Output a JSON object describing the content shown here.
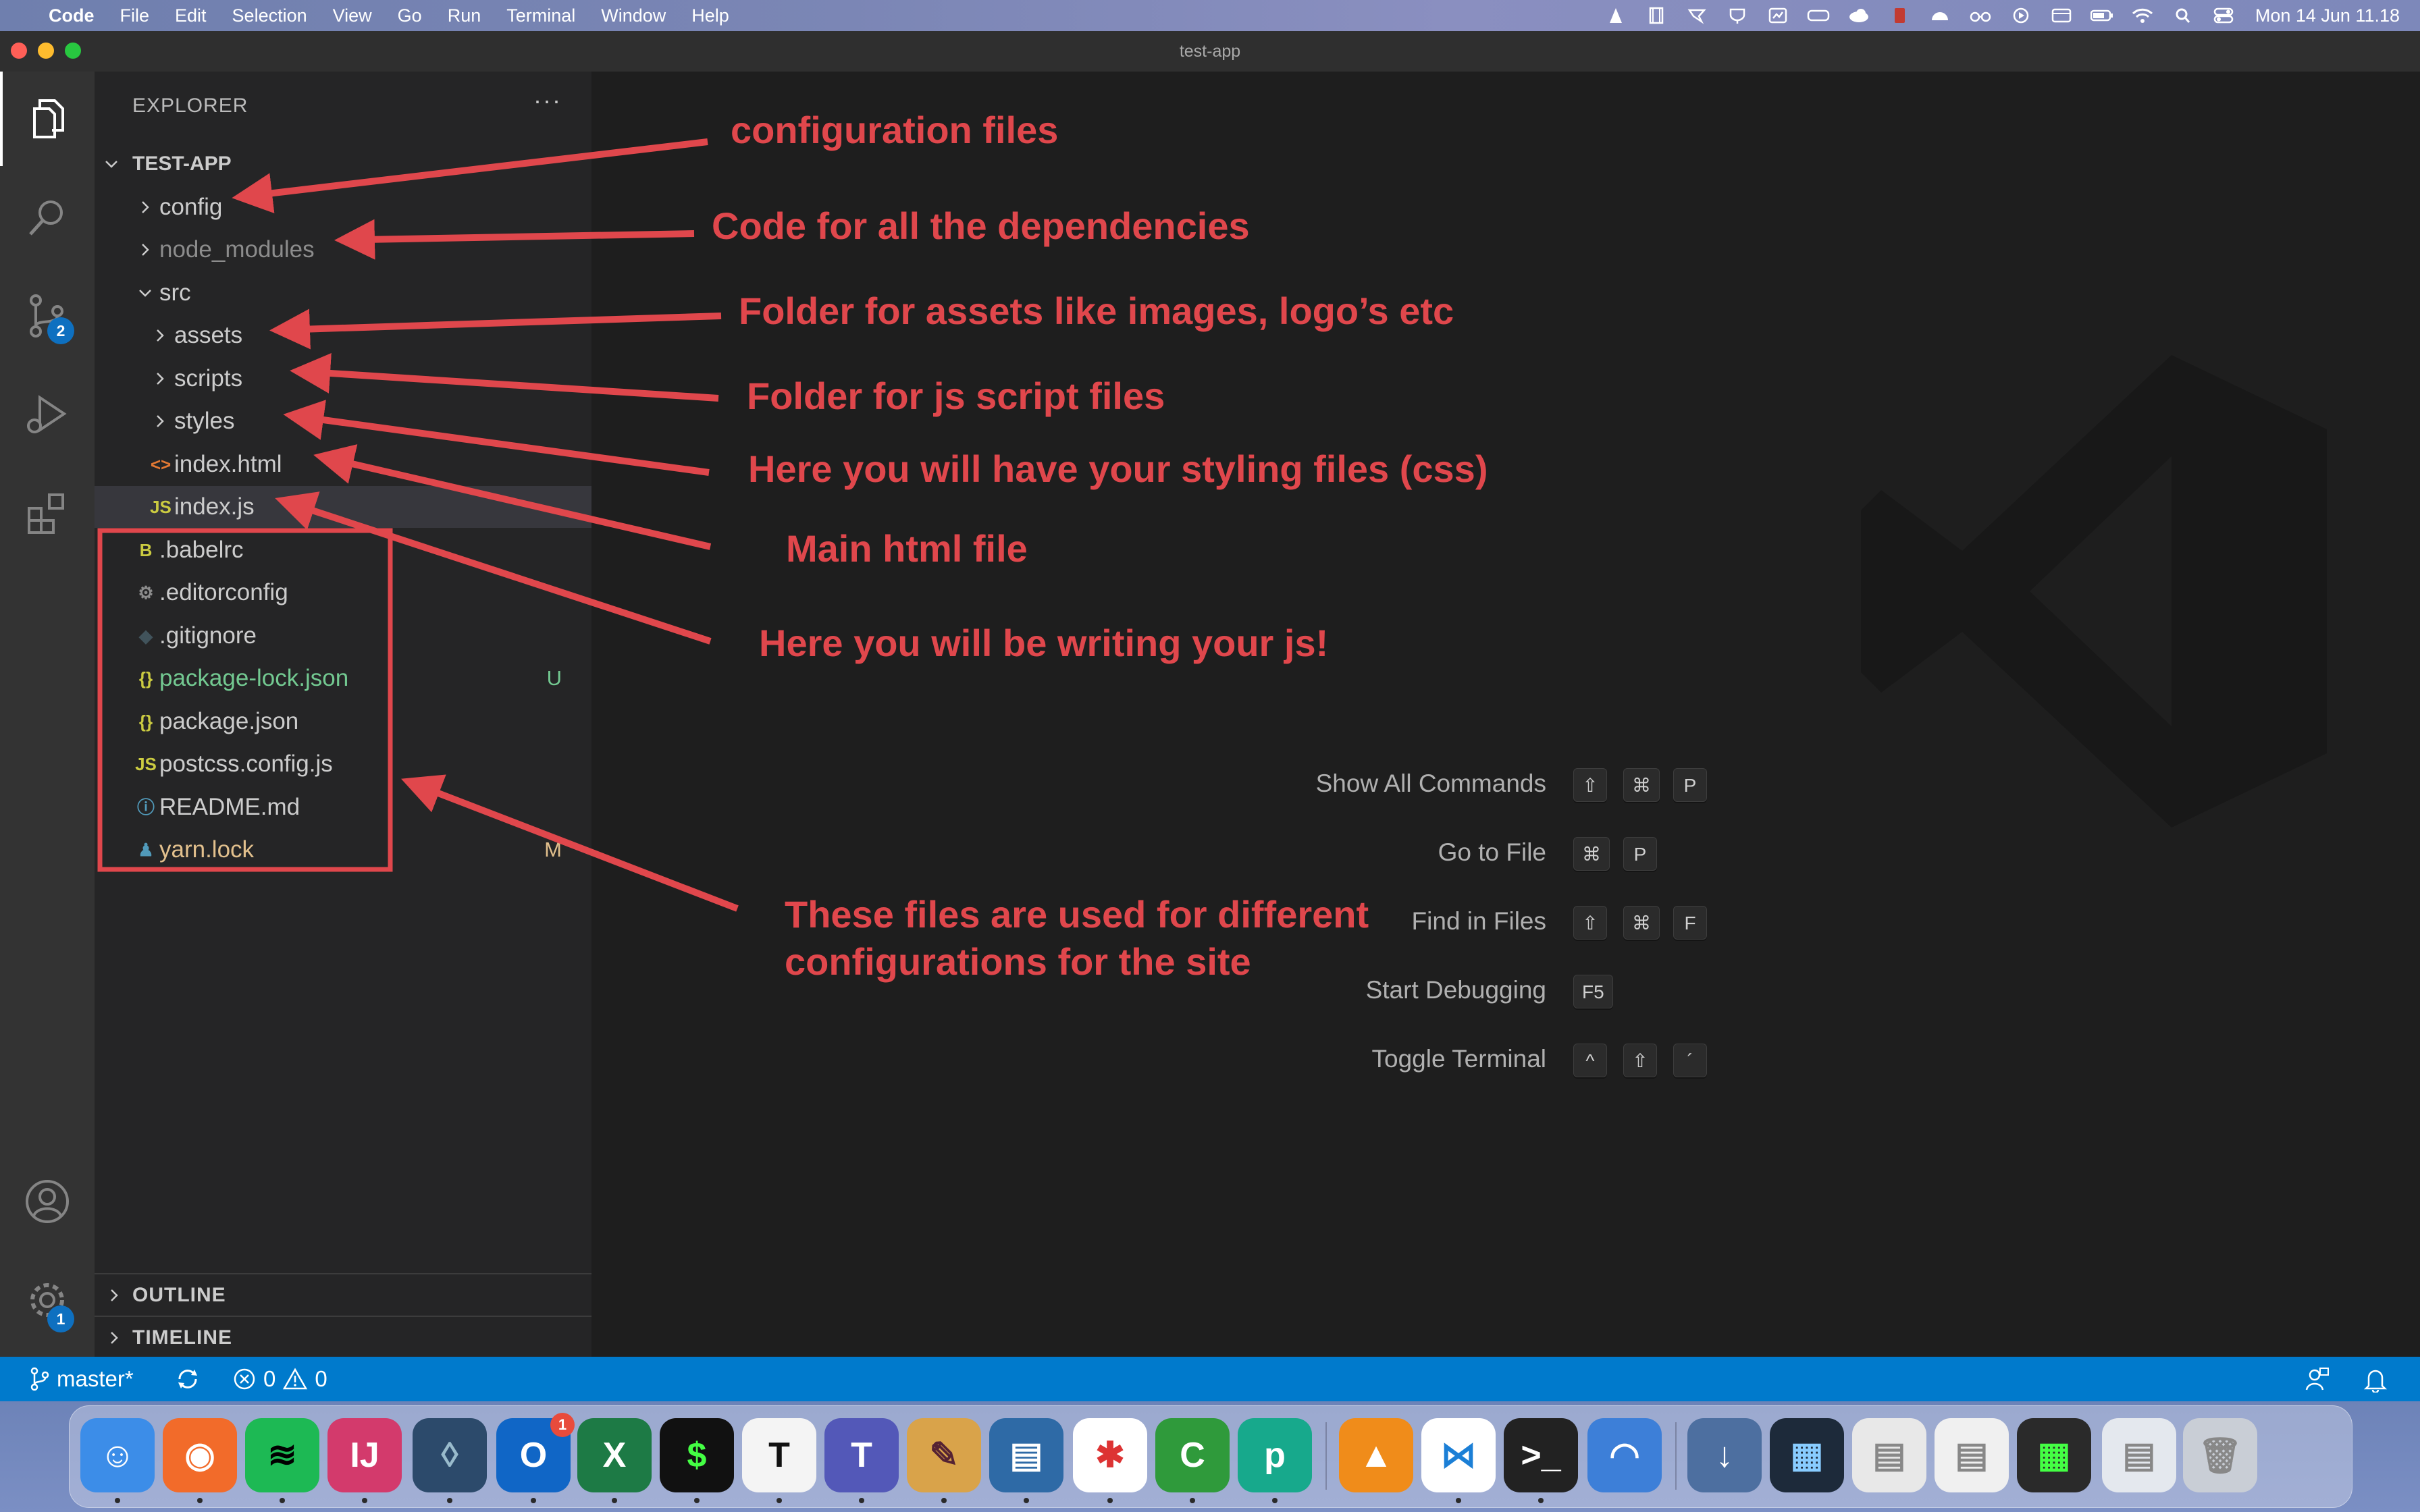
{
  "menubar": {
    "app_name": "Code",
    "menus": [
      "File",
      "Edit",
      "Selection",
      "View",
      "Go",
      "Run",
      "Terminal",
      "Window",
      "Help"
    ],
    "clock": "Mon 14 Jun  11.18",
    "status_icons": [
      "vlc-icon",
      "film-icon",
      "scissors-icon",
      "coffee-icon",
      "display-icon",
      "keyboard-icon",
      "cloud-icon",
      "pdf-icon",
      "weather-icon",
      "glasses-icon",
      "play-icon",
      "screen-icon",
      "battery-icon",
      "wifi-icon",
      "search-icon",
      "control-center-icon"
    ]
  },
  "window": {
    "title": "test-app"
  },
  "activity_bar": {
    "items": [
      {
        "icon": "files-icon",
        "badge": ""
      },
      {
        "icon": "search-icon",
        "badge": ""
      },
      {
        "icon": "source-control-icon",
        "badge": "2"
      },
      {
        "icon": "run-debug-icon",
        "badge": ""
      },
      {
        "icon": "extensions-icon",
        "badge": ""
      }
    ],
    "bottom": [
      {
        "icon": "account-icon",
        "badge": ""
      },
      {
        "icon": "settings-gear-icon",
        "badge": "1"
      }
    ]
  },
  "explorer": {
    "header": "EXPLORER",
    "more": "···",
    "root": "TEST-APP",
    "items": [
      {
        "label": "config",
        "type": "folder",
        "color": "#cccccc",
        "status": ""
      },
      {
        "label": "node_modules",
        "type": "folder",
        "color": "#8c8c8c",
        "status": ""
      },
      {
        "label": "src",
        "type": "folder-open",
        "color": "#cccccc",
        "status": ""
      },
      {
        "label": "assets",
        "type": "folder",
        "color": "#cccccc",
        "status": ""
      },
      {
        "label": "scripts",
        "type": "folder",
        "color": "#cccccc",
        "status": ""
      },
      {
        "label": "styles",
        "type": "folder",
        "color": "#cccccc",
        "status": ""
      },
      {
        "label": "index.html",
        "type": "file",
        "icon": "<>",
        "icon_color": "#e37933",
        "color": "#cccccc",
        "status": ""
      },
      {
        "label": "index.js",
        "type": "file",
        "icon": "JS",
        "icon_color": "#cbcb41",
        "color": "#cccccc",
        "status": ""
      },
      {
        "label": ".babelrc",
        "type": "file",
        "icon": "B",
        "icon_color": "#cbcb41",
        "color": "#cccccc",
        "status": ""
      },
      {
        "label": ".editorconfig",
        "type": "file",
        "icon": "⚙",
        "icon_color": "#8c8c8c",
        "color": "#cccccc",
        "status": ""
      },
      {
        "label": ".gitignore",
        "type": "file",
        "icon": "◆",
        "icon_color": "#41535b",
        "color": "#cccccc",
        "status": ""
      },
      {
        "label": "package-lock.json",
        "type": "file",
        "icon": "{}",
        "icon_color": "#cbcb41",
        "color": "#73c991",
        "status": "U",
        "status_color": "#73c991"
      },
      {
        "label": "package.json",
        "type": "file",
        "icon": "{}",
        "icon_color": "#cbcb41",
        "color": "#cccccc",
        "status": ""
      },
      {
        "label": "postcss.config.js",
        "type": "file",
        "icon": "JS",
        "icon_color": "#cbcb41",
        "color": "#cccccc",
        "status": ""
      },
      {
        "label": "README.md",
        "type": "file",
        "icon": "ⓘ",
        "icon_color": "#519aba",
        "color": "#cccccc",
        "status": ""
      },
      {
        "label": "yarn.lock",
        "type": "file",
        "icon": "♟",
        "icon_color": "#519aba",
        "color": "#e2c08d",
        "status": "M",
        "status_color": "#e2c08d"
      }
    ],
    "outline": "OUTLINE",
    "timeline": "TIMELINE"
  },
  "welcome": {
    "commands": [
      {
        "label": "Show All Commands",
        "keys": [
          "⇧",
          "⌘",
          "P"
        ]
      },
      {
        "label": "Go to File",
        "keys": [
          "⌘",
          "P"
        ]
      },
      {
        "label": "Find in Files",
        "keys": [
          "⇧",
          "⌘",
          "F"
        ]
      },
      {
        "label": "Start Debugging",
        "keys": [
          "F5"
        ]
      },
      {
        "label": "Toggle Terminal",
        "keys": [
          "^",
          "⇧",
          "´"
        ]
      }
    ]
  },
  "annotations": {
    "color": "#e0474c",
    "config": "configuration files",
    "node_modules": "Code for all the dependencies",
    "assets": "Folder for assets like images, logo’s etc",
    "scripts": "Folder for js script files",
    "styles": "Here you will have your styling files (css)",
    "html": "Main html file",
    "js": "Here you will be writing your js!",
    "config_files_1": "These files are used for different",
    "config_files_2": "configurations for the site"
  },
  "statusbar": {
    "branch": "master*",
    "errors": "0",
    "warnings": "0"
  },
  "dock": {
    "apps": [
      "finder-icon",
      "firefox-icon",
      "spotify-icon",
      "intellij-icon",
      "mysql-workbench-icon",
      "outlook-icon",
      "excel-icon",
      "iterm-icon",
      "typora-icon",
      "teams-icon",
      "paintbrush-icon",
      "archive-icon",
      "slack-icon",
      "camtasia-icon",
      "picsart-icon",
      "vlc-icon",
      "vscode-icon",
      "terminal-icon",
      "preview-icon",
      "downloads-icon",
      "window-1-icon",
      "window-2-icon",
      "window-3-icon",
      "window-4-icon",
      "window-5-icon",
      "trash-icon"
    ],
    "outlook_badge": "1"
  }
}
